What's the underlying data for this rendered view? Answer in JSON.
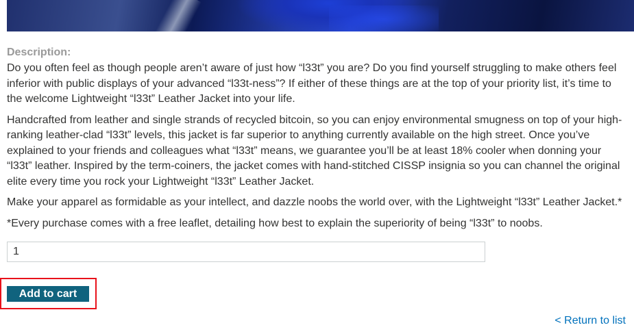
{
  "description": {
    "heading": "Description:",
    "paragraphs": [
      "Do you often feel as though people aren’t aware of just how “l33t” you are? Do you find yourself struggling to make others feel inferior with public displays of your advanced “l33t-ness”? If either of these things are at the top of your priority list, it’s time to the welcome Lightweight “l33t” Leather Jacket into your life.",
      "Handcrafted from leather and single strands of recycled bitcoin, so you can enjoy environmental smugness on top of your high-ranking leather-clad “l33t” levels, this jacket is far superior to anything currently available on the high street. Once you’ve explained to your friends and colleagues what “l33t” means, we guarantee you’ll be at least 18% cooler when donning your “l33t” leather. Inspired by the term-coiners, the jacket comes with hand-stitched CISSP insignia so you can channel the original elite every time you rock your Lightweight “l33t” Leather Jacket.",
      "Make your apparel as formidable as your intellect, and dazzle noobs the world over, with the Lightweight “l33t” Leather Jacket.*",
      "*Every purchase comes with a free leaflet, detailing how best to explain the superiority of being “l33t” to noobs."
    ]
  },
  "form": {
    "quantity_value": "1",
    "add_to_cart_label": "Add to cart"
  },
  "nav": {
    "return_label": "< Return to list"
  },
  "colors": {
    "button_bg": "#10637e",
    "link": "#0071bc",
    "highlight_border": "#e8111a",
    "heading_gray": "#999999"
  }
}
